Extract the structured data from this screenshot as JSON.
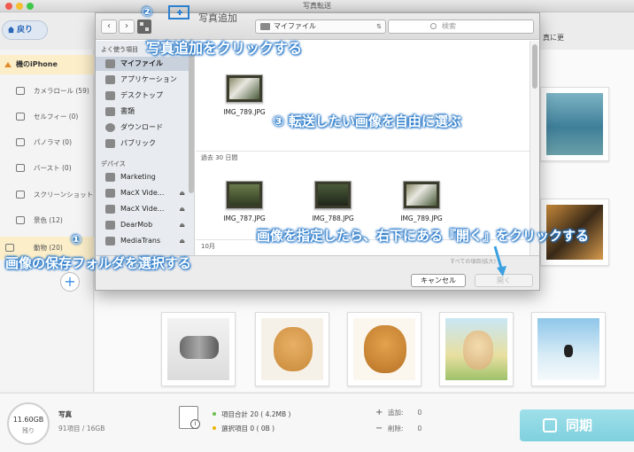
{
  "window": {
    "title": "写真転送"
  },
  "app": {
    "back_label": "戻り",
    "device_name": "機のiPhone",
    "albums": [
      {
        "label": "カメラロール (59)",
        "icon": "camera-icon"
      },
      {
        "label": "セルフィー (0)",
        "icon": "selfie-icon"
      },
      {
        "label": "パノラマ (0)",
        "icon": "panorama-icon"
      },
      {
        "label": "バースト (0)",
        "icon": "burst-icon"
      },
      {
        "label": "スクリーンショット",
        "icon": "screenshot-icon"
      },
      {
        "label": "景色 (12)",
        "icon": "landscape-icon"
      },
      {
        "label": "動物 (20)",
        "icon": "animal-icon"
      }
    ],
    "toolbar_right_text": "真に更",
    "add_album_symbol": "+"
  },
  "dialog": {
    "path_label": "マイファイル",
    "search_placeholder": "検索",
    "sidebar": {
      "favorites_header": "よく使う項目",
      "favorites": [
        "マイファイル",
        "アプリケーション",
        "デスクトップ",
        "書類",
        "ダウンロード",
        "パブリック"
      ],
      "devices_header": "デバイス",
      "devices": [
        "Marketing",
        "MacX Vide...",
        "MacX Vide...",
        "DearMob",
        "MediaTrans"
      ]
    },
    "files_top": [
      "IMG_789.JPG"
    ],
    "group_30days": "過去 30 日間",
    "files_30days": [
      "IMG_787.JPG",
      "IMG_788.JPG",
      "IMG_789.JPG"
    ],
    "group_october": "10月",
    "cancel_label": "キャンセル",
    "open_label": "開く",
    "small_hint": "すべての項目(拡大)"
  },
  "annotations": {
    "step2_num": "②",
    "step2_label": "写真追加",
    "step2_text": "写真追加をクリックする",
    "step3_text": "③ 転送したい画像を自由に選ぶ",
    "step_open_text": "画像を指定したら、右下にある『開く』をクリックする",
    "step1_num": "①",
    "step1_text": "画像の保存フォルダを選択する"
  },
  "status": {
    "capacity": "11.60GB",
    "capacity_label": "残り",
    "type": "写真",
    "count": "91項目 / 16GB",
    "total": "項目合計 20 ( 4.2MB )",
    "selected": "選択項目 0 ( 0B )",
    "add_label": "追加:",
    "add_value": "0",
    "remove_label": "削除:",
    "remove_value": "0",
    "sync_label": "同期",
    "colors": {
      "accent": "#3a8ee6",
      "total_dot": "#6cc04a",
      "selected_dot": "#f0b400"
    }
  }
}
